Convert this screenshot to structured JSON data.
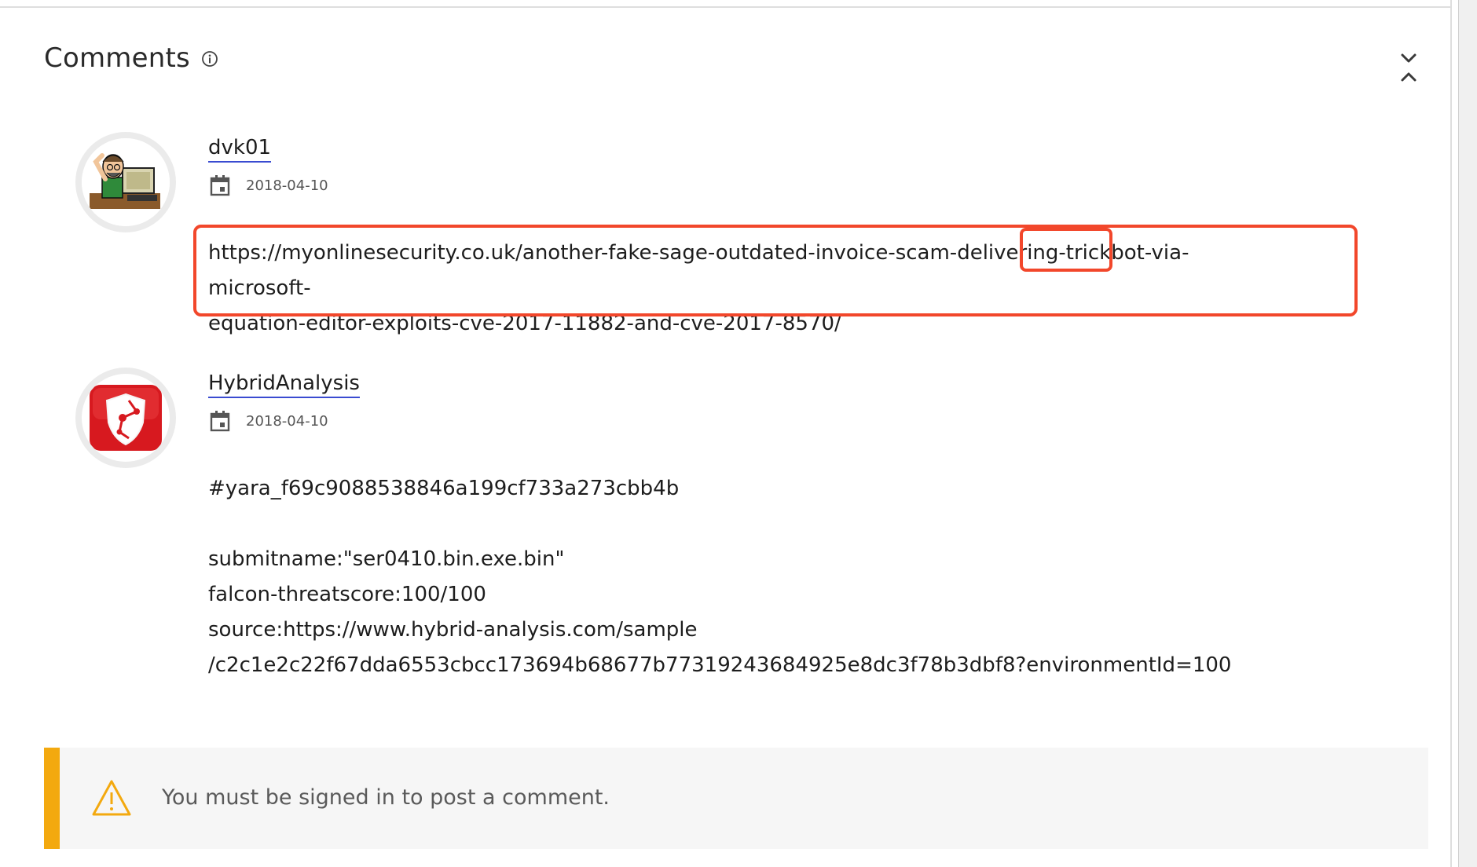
{
  "header": {
    "title": "Comments",
    "info_icon": "info-circle-icon",
    "collapse_icon": "collapse-chevrons-icon"
  },
  "comments": [
    {
      "author": "dvk01",
      "date": "2018-04-10",
      "avatar": "cartoon-man-at-computer-avatar",
      "lines": [
        "https://myonlinesecurity.co.uk/another-fake-sage-outdated-invoice-scam-delivering-trickbot-via-microsoft-",
        "equation-editor-exploits-cve-2017-11882-and-cve-2017-8570/"
      ]
    },
    {
      "author": "HybridAnalysis",
      "date": "2018-04-10",
      "avatar": "hybrid-analysis-shield-logo",
      "lines": [
        "#yara_f69c9088538846a199cf733a273cbb4b",
        "",
        "submitname:\"ser0410.bin.exe.bin\"",
        "falcon-threatscore:100/100",
        "source:https://www.hybrid-analysis.com/sample",
        "/c2c1e2c22f67dda6553cbcc173694b68677b77319243684925e8dc3f78b3dbf8?environmentId=100"
      ]
    }
  ],
  "notice": {
    "text": "You must be signed in to post a comment.",
    "icon": "warning-triangle-icon"
  },
  "colors": {
    "accent_underline": "#3a4bd1",
    "highlight": "#f2472b",
    "notice_bar": "#f3a90f",
    "notice_bg": "#f6f6f6"
  }
}
